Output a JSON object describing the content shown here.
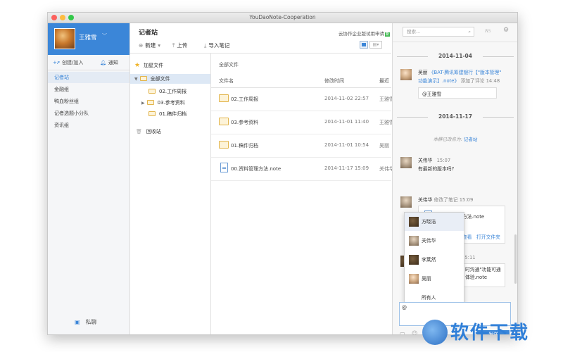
{
  "window": {
    "title": "YouDaoNote-Cooperation"
  },
  "profile": {
    "name": "王雅雪",
    "arrow": "﹀"
  },
  "sidebar": {
    "create_join": "创建/加入",
    "notify": "通知",
    "groups": [
      "记者站",
      "金融组",
      "鸭血粉丝组",
      "记者选题小分队",
      "资讯组"
    ],
    "private_chat": "私聊"
  },
  "notebook": {
    "title": "记者站",
    "promo": "云协作企业版试用申请",
    "promo_badge": "新",
    "toolbar": {
      "new": "新建",
      "upload": "上传",
      "import": "导入笔记"
    }
  },
  "tree": {
    "starred": "加星文件",
    "all": "全部文件",
    "children": [
      "02.工作周报",
      "03.参考资料",
      "01.稿件归档"
    ],
    "trash": "回收站"
  },
  "list": {
    "breadcrumb": "全部文件",
    "headers": {
      "name": "文件名",
      "modified": "修改时间",
      "last": "最近"
    },
    "rows": [
      {
        "name": "02.工作周报",
        "date": "2014-11-02 22:57",
        "owner": "王雅雪"
      },
      {
        "name": "03.参考资料",
        "date": "2014-11-01 11:40",
        "owner": "王雅雪"
      },
      {
        "name": "01.稿件归档",
        "date": "2014-11-01 10:54",
        "owner": "吴丽"
      },
      {
        "name": "00.资料管理方法.note",
        "date": "2014-11-17 15:09",
        "owner": "关伟华"
      }
    ]
  },
  "chat": {
    "search_placeholder": "搜索...",
    "people_count": "5",
    "date1": "2014-11-04",
    "m1": {
      "name": "吴丽",
      "text1": "《BAT-腾讯筹建银行【\"版本管理\"",
      "text2": "功能演示】.note》",
      "action": "添加了评论",
      "time": "14:48",
      "comment": "@王雅雪"
    },
    "date2": "2014-11-17",
    "sys": {
      "prefix": "本群已改名为:",
      "name": "记者站"
    },
    "m2": {
      "name": "关伟华",
      "time": "15:07",
      "text": "有最新的版本吗?"
    },
    "m3": {
      "name": "关伟华",
      "action": "修改了笔记",
      "time": "15:09",
      "file": "00.资料管理方法.note",
      "view": "查看",
      "open_folder": "打开文件夹"
    },
    "m4": {
      "time": "15:11",
      "text1": "时沟通\"功能可通",
      "text2": "体验.note"
    },
    "mentions": [
      "方晓洁",
      "关伟华",
      "李莱然",
      "吴丽",
      "所有人"
    ],
    "input_value": "@",
    "send": "发送"
  },
  "watermark": {
    "text": "软件下载"
  }
}
